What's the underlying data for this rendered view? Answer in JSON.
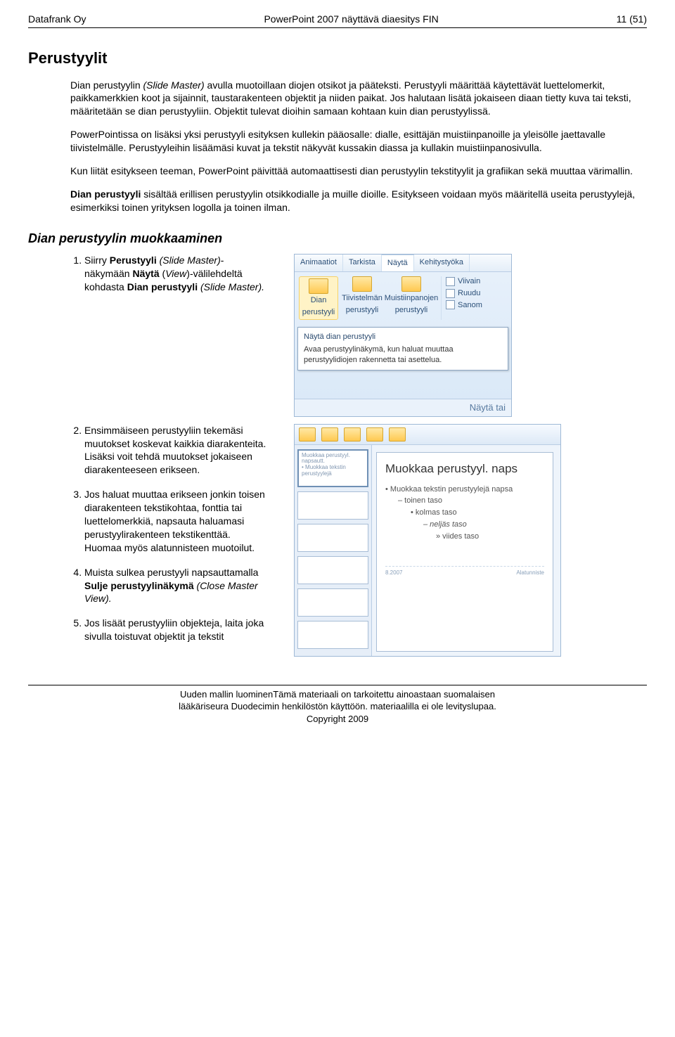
{
  "header": {
    "left": "Datafrank Oy",
    "center": "PowerPoint 2007 näyttävä diaesitys FIN",
    "right": "11 (51)"
  },
  "section_title": "Perustyylit",
  "paragraphs": {
    "p1a": "Dian perustyylin ",
    "p1b": "(Slide Master)",
    "p1c": " avulla muotoillaan diojen otsikot ja pääteksti. Perustyyli määrittää käytettävät luettelomerkit, paikkamerkkien koot ja sijainnit, taustarakenteen objektit ja niiden paikat. Jos halutaan lisätä jokaiseen diaan tietty kuva tai teksti, määritetään se dian perustyyliin. Objektit tulevat dioihin samaan kohtaan kuin dian perustyylissä.",
    "p2": "PowerPointissa on lisäksi yksi perustyyli esityksen kullekin pääosalle: dialle, esittäjän muistiinpanoille ja yleisölle jaettavalle tiivistelmälle. Perustyyleihin lisäämäsi kuvat ja tekstit näkyvät kussakin diassa ja kullakin muistiinpanosivulla.",
    "p3": "Kun liität esitykseen teeman, PowerPoint päivittää automaattisesti dian perustyylin tekstityylit ja grafiikan sekä muuttaa värimallin.",
    "p4a": "Dian perustyyli",
    "p4b": " sisältää erillisen perustyylin otsikkodialle ja muille dioille. Esitykseen voidaan myös määritellä useita perustyylejä, esimerkiksi toinen yrityksen logolla ja toinen ilman."
  },
  "subsection_title": "Dian perustyylin muokkaaminen",
  "steps": {
    "s1a": "Siirry ",
    "s1b": "Perustyyli ",
    "s1c": "(Slide Master)",
    "s1d": "-näkymään ",
    "s1e": "Näytä",
    "s1f": " (",
    "s1g": "View",
    "s1h": ")-välilehdeltä kohdasta ",
    "s1i": "Dian perustyyli ",
    "s1j": "(Slide Master).",
    "s2": "Ensimmäiseen perustyyliin tekemäsi muutokset koskevat kaikkia diarakenteita. Lisäksi voit tehdä muutokset jokaiseen diarakenteeseen erikseen.",
    "s3": "Jos haluat muuttaa erikseen jonkin toisen diarakenteen tekstikohtaa, fonttia tai luettelomerkkiä, napsauta haluamasi perustyylirakenteen tekstikenttää. Huomaa myös alatunnisteen muotoilut.",
    "s4a": "Muista sulkea perustyyli napsauttamalla ",
    "s4b": "Sulje perustyylinäkymä ",
    "s4c": "(Close Master View).",
    "s5": "Jos lisäät perustyyliin objekteja, laita joka sivulla toistuvat objektit ja tekstit"
  },
  "mock1": {
    "tab1": "Animaatiot",
    "tab2": "Tarkista",
    "tab3": "Näytä",
    "tab4": "Kehitystyöka",
    "btn1a": "Dian",
    "btn1b": "perustyyli",
    "btn2a": "Tiivistelmän",
    "btn2b": "perustyyli",
    "btn3a": "Muistiinpanojen",
    "btn3b": "perustyyli",
    "opt1": "Viivain",
    "opt2": "Ruudu",
    "opt3": "Sanom",
    "tooltip_title": "Näytä dian perustyyli",
    "tooltip_body": "Avaa perustyylinäkymä, kun haluat muuttaa perustyylidiojen rakennetta tai asettelua.",
    "footer_link": "Näytä tai"
  },
  "mock2": {
    "stage_title": "Muokkaa perustyyl. naps",
    "bullet1": "Muokkaa tekstin perustyylejä napsa",
    "bullet2": "– toinen taso",
    "bullet3": "• kolmas taso",
    "bullet4": "– neljäs taso",
    "bullet5": "» viides taso",
    "ftr_left": "8.2007",
    "ftr_right": "Alatunniste",
    "thumb_big_t": "Muokkaa perustyyl. napsautt.",
    "thumb_big_b": "• Muokkaa tekstin perustyylejä"
  },
  "footer": {
    "l1": "Uuden mallin luominenTämä materiaali on tarkoitettu ainoastaan suomalaisen",
    "l2": "lääkäriseura Duodecimin henkilöstön käyttöön. materiaalilla ei ole levityslupaa.",
    "l3": "Copyright 2009"
  }
}
